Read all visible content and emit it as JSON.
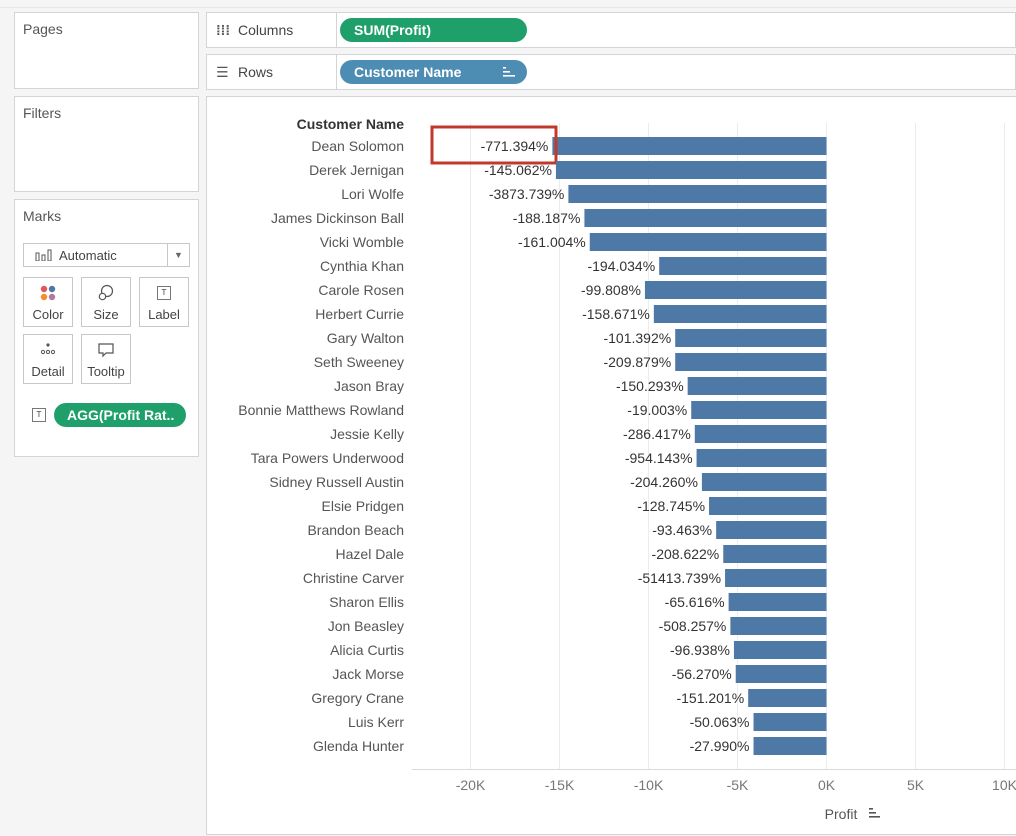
{
  "panels": {
    "pages": "Pages",
    "filters": "Filters",
    "marks": "Marks"
  },
  "marks": {
    "type": "Automatic",
    "cards": {
      "color": "Color",
      "size": "Size",
      "label": "Label",
      "detail": "Detail",
      "tooltip": "Tooltip"
    },
    "label_pill": "AGG(Profit Rat.."
  },
  "shelves": {
    "columns_label": "Columns",
    "rows_label": "Rows",
    "columns_pill": "SUM(Profit)",
    "rows_pill": "Customer Name"
  },
  "colors": {
    "bar": "#4e79a7",
    "measure_pill": "#1fa06a",
    "dimension_pill": "#4d8db3",
    "highlight": "#c0392b"
  },
  "highlight_row": 0,
  "chart_data": {
    "type": "bar",
    "orientation": "horizontal",
    "row_header": "Customer Name",
    "xlabel": "Profit",
    "xlim": [
      -23000,
      10500
    ],
    "x_ticks": [
      -20000,
      -15000,
      -10000,
      -5000,
      0,
      5000,
      10000
    ],
    "x_tick_labels": [
      "-20K",
      "-15K",
      "-10K",
      "-5K",
      "0K",
      "5K",
      "10K"
    ],
    "gridlines": true,
    "categories": [
      "Dean Solomon",
      "Derek Jernigan",
      "Lori Wolfe",
      "James Dickinson Ball",
      "Vicki Womble",
      "Cynthia Khan",
      "Carole Rosen",
      "Herbert Currie",
      "Gary Walton",
      "Seth Sweeney",
      "Jason Bray",
      "Bonnie Matthews Rowland",
      "Jessie Kelly",
      "Tara Powers Underwood",
      "Sidney Russell Austin",
      "Elsie Pridgen",
      "Brandon Beach",
      "Hazel Dale",
      "Christine Carver",
      "Sharon Ellis",
      "Jon Beasley",
      "Alicia Curtis",
      "Jack Morse",
      "Gregory Crane",
      "Luis Kerr",
      "Glenda Hunter"
    ],
    "values": [
      -15400,
      -15200,
      -14500,
      -13600,
      -13300,
      -9400,
      -10200,
      -9700,
      -8500,
      -8500,
      -7800,
      -7600,
      -7400,
      -7300,
      -7000,
      -6600,
      -6200,
      -5800,
      -5700,
      -5500,
      -5400,
      -5200,
      -5100,
      -4400,
      -4100,
      -4100
    ],
    "labels": [
      "-771.394%",
      "-145.062%",
      "-3873.739%",
      "-188.187%",
      "-161.004%",
      "-194.034%",
      "-99.808%",
      "-158.671%",
      "-101.392%",
      "-209.879%",
      "-150.293%",
      "-19.003%",
      "-286.417%",
      "-954.143%",
      "-204.260%",
      "-128.745%",
      "-93.463%",
      "-208.622%",
      "-51413.739%",
      "-65.616%",
      "-508.257%",
      "-96.938%",
      "-56.270%",
      "-151.201%",
      "-50.063%",
      "-27.990%"
    ]
  }
}
